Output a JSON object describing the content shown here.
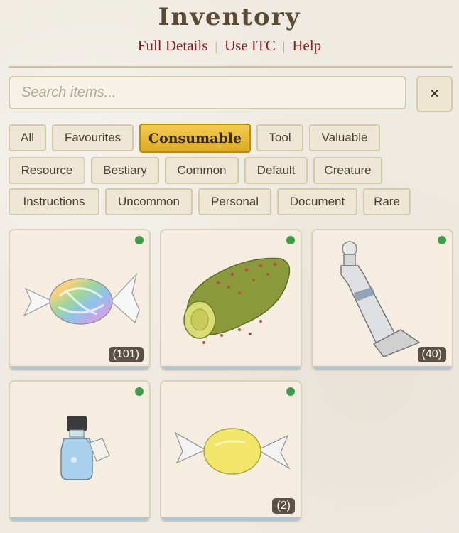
{
  "header": {
    "title": "Inventory",
    "links": [
      "Full Details",
      "Use ITC",
      "Help"
    ]
  },
  "search": {
    "placeholder": "Search items...",
    "value": "",
    "clear_label": "×"
  },
  "filters": {
    "active": "Consumable",
    "row1": [
      "All",
      "Favourites",
      "Consumable",
      "Tool",
      "Valuable"
    ],
    "row2": [
      "Resource",
      "Bestiary",
      "Common",
      "Default",
      "Creature"
    ],
    "row3": [
      "Instructions",
      "Uncommon",
      "Personal",
      "Document",
      "Rare"
    ]
  },
  "items": [
    {
      "icon": "rainbow-candy-icon",
      "count": "(101)"
    },
    {
      "icon": "pickle-icon",
      "count": ""
    },
    {
      "icon": "paint-tube-icon",
      "count": "(40)"
    },
    {
      "icon": "potion-bottle-icon",
      "count": ""
    },
    {
      "icon": "lemon-candy-icon",
      "count": "(2)"
    }
  ],
  "colors": {
    "accent_link": "#8b1a1a",
    "active_filter": "#e2b231",
    "status_dot": "#3f9c48",
    "card_bg": "#f4ede0"
  }
}
